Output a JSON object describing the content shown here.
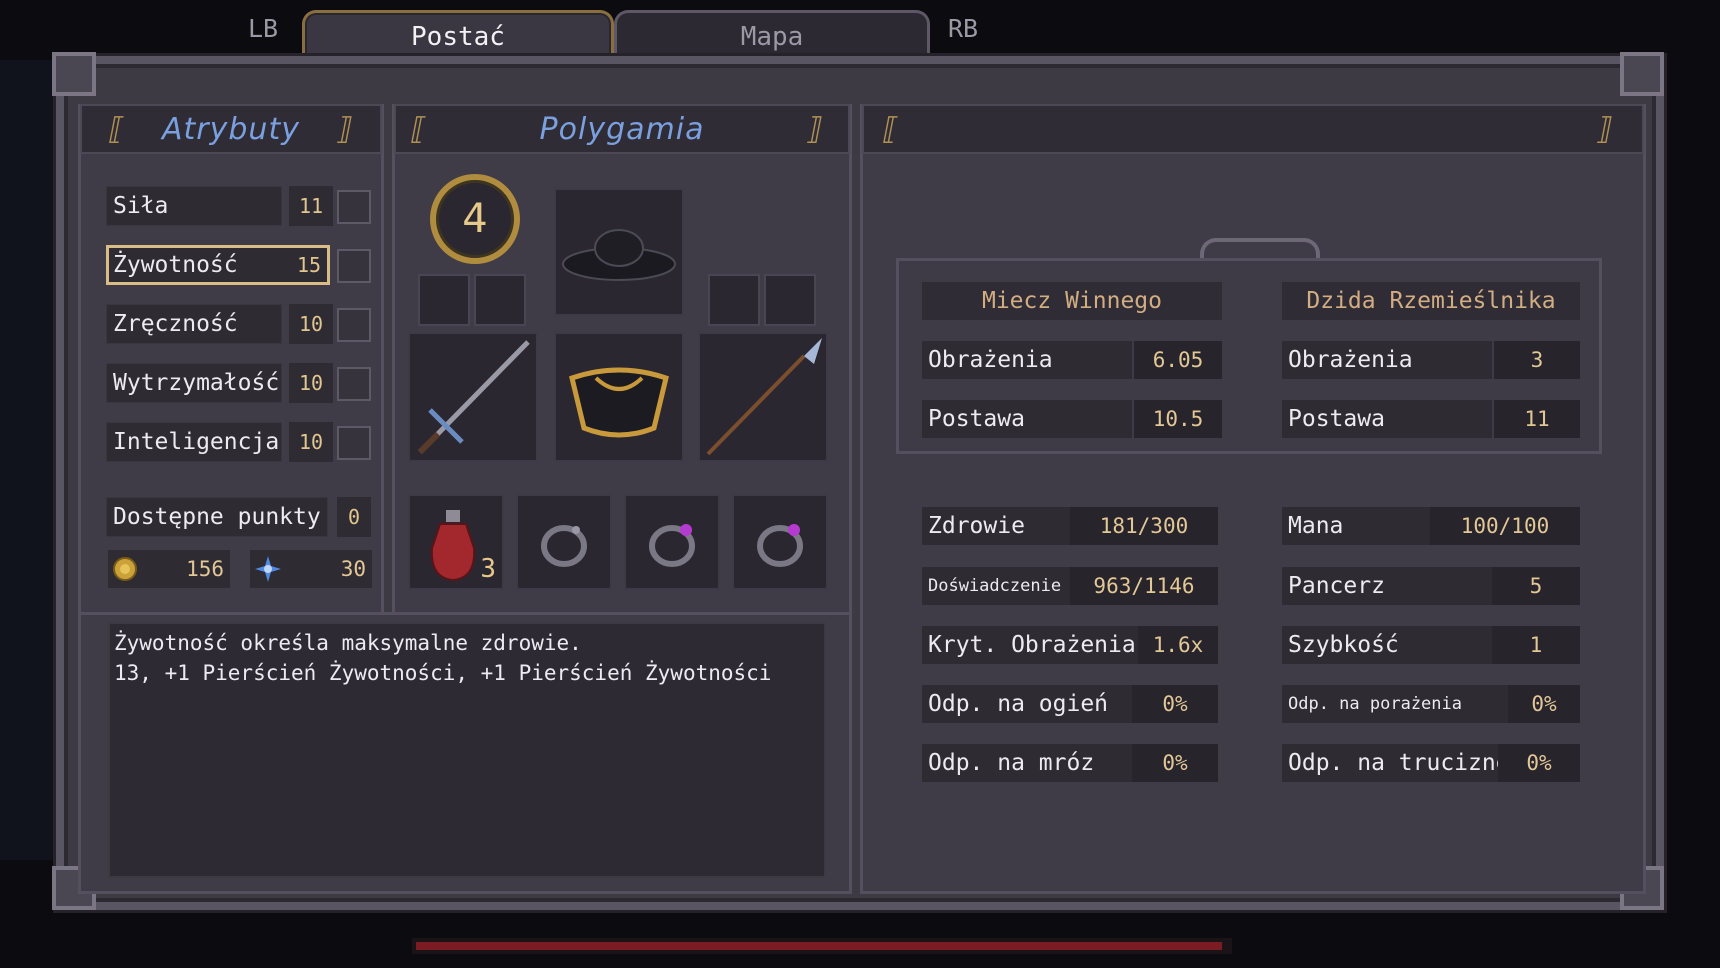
{
  "tabs": {
    "lb": "LB",
    "rb": "RB",
    "items": [
      {
        "label": "Postać",
        "active": true
      },
      {
        "label": "Mapa",
        "active": false
      }
    ]
  },
  "attributes_panel": {
    "title": "Atrybuty",
    "attributes": [
      {
        "name": "Siła",
        "value": "11"
      },
      {
        "name": "Żywotność",
        "value": "15",
        "selected": true
      },
      {
        "name": "Zręczność",
        "value": "10"
      },
      {
        "name": "Wytrzymałość",
        "value": "10"
      },
      {
        "name": "Inteligencja",
        "value": "10"
      }
    ],
    "available_points_label": "Dostępne punkty",
    "available_points_value": "0",
    "gold": "156",
    "souls": "30",
    "gold_icon": "gold-coin-icon",
    "souls_icon": "blue-star-icon"
  },
  "equipment_panel": {
    "title": "Polygamia",
    "level": "4",
    "potion_count": "3"
  },
  "description": {
    "line1": "Żywotność określa maksymalne zdrowie.",
    "line2": "13, +1 Pierścień Żywotności, +1 Pierścień Żywotności"
  },
  "weapons": [
    {
      "name": "Miecz Winnego",
      "damage_label": "Obrażenia",
      "damage": "6.05",
      "stance_label": "Postawa",
      "stance": "10.5"
    },
    {
      "name": "Dzida Rzemieślnika",
      "damage_label": "Obrażenia",
      "damage": "3",
      "stance_label": "Postawa",
      "stance": "11"
    }
  ],
  "stats_left": [
    {
      "label": "Zdrowie",
      "value": "181/300"
    },
    {
      "label": "Doświadczenie",
      "value": "963/1146"
    },
    {
      "label": "Kryt. Obrażenia",
      "value": "1.6x"
    },
    {
      "label": "Odp. na ogień",
      "value": "0%"
    },
    {
      "label": "Odp. na mróz",
      "value": "0%"
    }
  ],
  "stats_right": [
    {
      "label": "Mana",
      "value": "100/100"
    },
    {
      "label": "Pancerz",
      "value": "5"
    },
    {
      "label": "Szybkość",
      "value": "1"
    },
    {
      "label": "Odp. na porażenia",
      "value": "0%"
    },
    {
      "label": "Odp. na truciznę",
      "value": "0%"
    }
  ],
  "colors": {
    "accent_gold": "#d8bd86",
    "header_blue": "#7aa0e0",
    "health_bar": "#7a1c22"
  }
}
